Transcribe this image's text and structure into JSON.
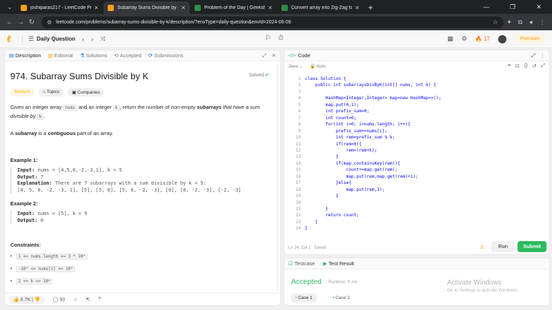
{
  "browser": {
    "tabs": [
      {
        "title": "joshiparas217 - LeetCode Profi",
        "favicon_color": "#ffa116"
      },
      {
        "title": "Subarray Sums Divisible by K - ",
        "favicon_color": "#ffa116"
      },
      {
        "title": "Problem of the Day | GeeksforG",
        "favicon_color": "#2f8d46"
      },
      {
        "title": "Convert array into Zig-Zag fash",
        "favicon_color": "#2f8d46"
      }
    ],
    "active_tab_index": 1,
    "url": "leetcode.com/problems/subarray-sums-divisible-by-k/description/?envType=daily-question&envId=2024-06-09"
  },
  "lc_nav": {
    "title": "Daily Question",
    "streak": "17",
    "premium": "Premium"
  },
  "left": {
    "tabs": [
      {
        "label": "Description",
        "icon": "document-icon"
      },
      {
        "label": "Editorial",
        "icon": "book-icon"
      },
      {
        "label": "Solutions",
        "icon": "flask-icon"
      },
      {
        "label": "Accepted",
        "icon": "history-icon"
      },
      {
        "label": "Submissions",
        "icon": "submissions-icon"
      }
    ],
    "problem_title": "974. Subarray Sums Divisible by K",
    "solved": "Solved",
    "tags": [
      "Medium",
      "Topics",
      "Companies"
    ],
    "description": {
      "p1_a": "Given an integer array ",
      "p1_code1": "nums",
      "p1_b": " and an integer ",
      "p1_code2": "k",
      "p1_c": ", return the number of non-empty ",
      "p1_bold": "subarrays",
      "p1_d": " that have a sum divisible by ",
      "p1_code3": "k",
      "p1_e": ".",
      "p2_bold1": "subarray",
      "p2_a": "A ",
      "p2_b": " is a ",
      "p2_bold2": "contiguous",
      "p2_c": " part of an array."
    },
    "example1": {
      "heading": "Example 1:",
      "input_label": "Input:",
      "input": "nums = [4,5,0,-2,-3,1], k = 5",
      "output_label": "Output:",
      "output": "7",
      "expl_label": "Explanation:",
      "explanation": "There are 7 subarrays with a sum divisible by k = 5:",
      "expl_line2": "[4, 5, 0, -2, -3, 1], [5], [5, 0], [5, 0, -2, -3], [0], [0, -2, -3], [-2, -3]"
    },
    "example2": {
      "heading": "Example 2:",
      "input_label": "Input:",
      "input": "nums = [5], k = 9",
      "output_label": "Output:",
      "output": "0"
    },
    "constraints_heading": "Constraints:",
    "constraints": [
      "1 <= nums.length <= 3 * 10⁴",
      "-10⁴ <= nums[i] <= 10⁴",
      "2 <= k <= 10⁴"
    ],
    "footer": {
      "likes": "6.7K",
      "comments": "93"
    }
  },
  "code": {
    "header": "Code",
    "language": "Java",
    "auto": "Auto",
    "lines": [
      "class Solution {",
      "    public int subarraysDivByK(int[] nums, int k) {",
      "",
      "        HashMap<Integer,Integer> map=new HashMap<>();",
      "        map.put(0,1);",
      "        int prefix_sum=0;",
      "        int count=0;",
      "        for(int i=0; i<nums.length; i++){",
      "            prefix_sum+=nums[i];",
      "            int rem=prefix_sum % k;",
      "            if(rem<0){",
      "                rem=(rem+k);",
      "            }",
      "            if(map.containsKey(rem)){",
      "                count+=map.get(rem);",
      "                map.put(rem,map.get(rem)+1);",
      "            }else{",
      "                map.put(rem,1);",
      "            }",
      "",
      "        }",
      "        return count;",
      "    }",
      "}"
    ],
    "status": "Ln 24, Col 2",
    "saved": "Saved",
    "run": "Run",
    "submit": "Submit"
  },
  "test": {
    "tab1": "Testcase",
    "tab2": "Test Result",
    "result": "Accepted",
    "runtime": "Runtime: 0 ms",
    "cases": [
      "Case 1",
      "Case 2"
    ],
    "watermark1": "Activate Windows",
    "watermark2": "Go to Settings to activate Windows."
  }
}
